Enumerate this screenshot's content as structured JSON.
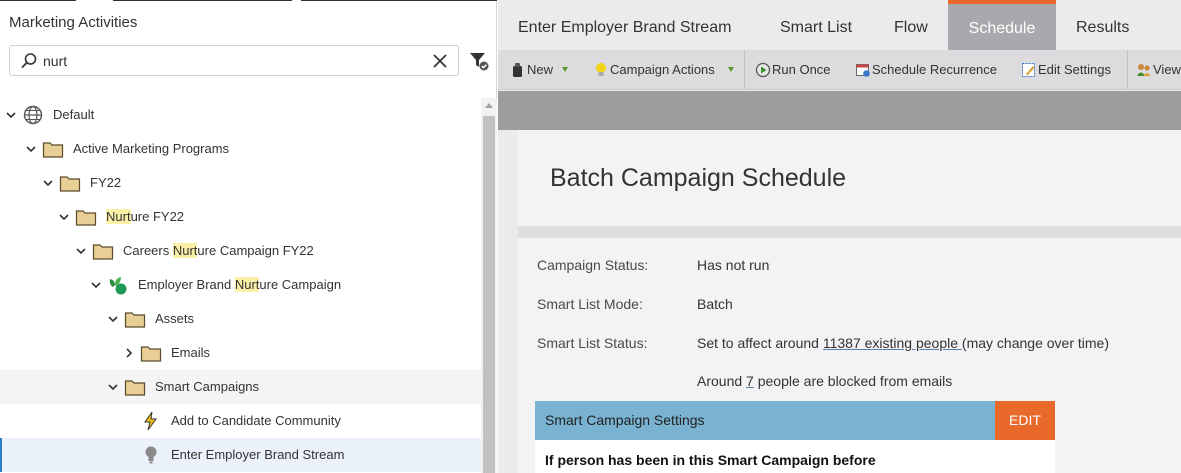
{
  "left_panel": {
    "title": "Marketing Activities",
    "search": {
      "value": "nurt",
      "placeholder": ""
    },
    "tree": [
      {
        "pre": "",
        "match": "",
        "post": "Default",
        "icon": "globe-icon",
        "expanded": true,
        "depth": 0,
        "state": ""
      },
      {
        "pre": "",
        "match": "",
        "post": "Active Marketing Programs",
        "icon": "folder-icon",
        "expanded": true,
        "depth": 1,
        "state": ""
      },
      {
        "pre": "",
        "match": "",
        "post": "FY22",
        "icon": "folder-icon",
        "expanded": true,
        "depth": 2,
        "state": ""
      },
      {
        "pre": "",
        "match": "Nurt",
        "post": "ure FY22",
        "icon": "folder-icon",
        "expanded": true,
        "depth": 3,
        "state": ""
      },
      {
        "pre": "Careers ",
        "match": "Nurt",
        "post": "ure Campaign FY22",
        "icon": "folder-icon",
        "expanded": true,
        "depth": 4,
        "state": ""
      },
      {
        "pre": "Employer Brand ",
        "match": "Nurt",
        "post": "ure Campaign",
        "icon": "program-icon",
        "expanded": true,
        "depth": 5,
        "state": ""
      },
      {
        "pre": "",
        "match": "",
        "post": "Assets",
        "icon": "folder-icon",
        "expanded": true,
        "depth": 6,
        "state": ""
      },
      {
        "pre": "",
        "match": "",
        "post": "Emails",
        "icon": "folder-icon",
        "expanded": false,
        "depth": 7,
        "state": ""
      },
      {
        "pre": "",
        "match": "",
        "post": "Smart Campaigns",
        "icon": "folder-icon",
        "expanded": true,
        "depth": 6,
        "state": "hover"
      },
      {
        "pre": "",
        "match": "",
        "post": "Add to Candidate Community",
        "icon": "lightning-icon",
        "expanded": null,
        "depth": 7,
        "state": ""
      },
      {
        "pre": "",
        "match": "",
        "post": "Enter Employer Brand Stream",
        "icon": "lightbulb-icon",
        "expanded": null,
        "depth": 7,
        "state": "selected"
      }
    ]
  },
  "tabs": [
    {
      "label": "Enter Employer Brand Stream",
      "active": false
    },
    {
      "label": "Smart List",
      "active": false
    },
    {
      "label": "Flow",
      "active": false
    },
    {
      "label": "Schedule",
      "active": true
    },
    {
      "label": "Results",
      "active": false
    }
  ],
  "toolbar": {
    "new": "New",
    "campaign_actions": "Campaign Actions",
    "run_once": "Run Once",
    "schedule_recurrence": "Schedule Recurrence",
    "edit_settings": "Edit Settings",
    "view": "View"
  },
  "schedule": {
    "title": "Batch Campaign Schedule",
    "campaign_status_label": "Campaign Status:",
    "campaign_status_value": "Has not run",
    "smart_list_mode_label": "Smart List Mode:",
    "smart_list_mode_value": "Batch",
    "smart_list_status_label": "Smart List Status:",
    "status_prefix": "Set to affect around ",
    "status_link": "11387 existing people ",
    "status_suffix": "(may change over time)",
    "blocked_prefix": "Around ",
    "blocked_link": "7",
    "blocked_suffix": " people are blocked from emails",
    "settings_header": "Smart Campaign Settings",
    "edit_label": "EDIT",
    "settings_first_line": "If person has been in this Smart Campaign before"
  },
  "colors": {
    "accent_orange": "#e8692a",
    "active_tab_bg": "#a9a9ad",
    "settings_bar_blue": "#79b3d1",
    "search_highlight": "#fbf0a8",
    "selected_row_bg": "#eaf1fa"
  }
}
